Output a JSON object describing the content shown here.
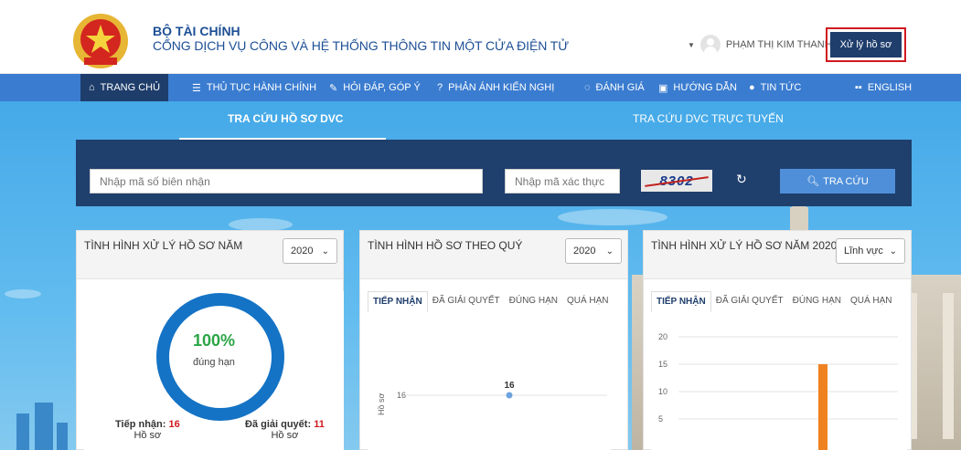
{
  "header": {
    "org_name": "BỘ TÀI CHÍNH",
    "org_subtitle": "CỔNG DỊCH VỤ CÔNG VÀ HỆ THỐNG THÔNG TIN MỘT CỬA ĐIỆN TỬ",
    "user_name": "PHẠM THỊ KIM THANH",
    "process_button": "Xử lý hồ sơ"
  },
  "nav": {
    "items": [
      {
        "label": "TRANG CHỦ",
        "icon": "home-icon"
      },
      {
        "label": "THỦ TỤC HÀNH CHÍNH",
        "icon": "list-icon"
      },
      {
        "label": "HỎI ĐÁP, GÓP Ý",
        "icon": "wrench-icon"
      },
      {
        "label": "PHẢN ÁNH KIẾN NGHỊ",
        "icon": "question-icon"
      },
      {
        "label": "ĐÁNH GIÁ",
        "icon": "chat-icon"
      },
      {
        "label": "HƯỚNG DẪN",
        "icon": "book-icon"
      },
      {
        "label": "TIN TỨC",
        "icon": "location-icon"
      },
      {
        "label": "ENGLISH",
        "icon": "flag-icon"
      }
    ]
  },
  "tabs": {
    "lookup_dvc": "TRA CỨU HỒ SƠ DVC",
    "lookup_online": "TRA CỨU DVC TRỰC TUYẾN"
  },
  "search": {
    "receipt_placeholder": "Nhập mã số biên nhận",
    "captcha_placeholder": "Nhập mã xác thực",
    "captcha_text": "8302",
    "button_label": "TRA CỨU"
  },
  "card1": {
    "title": "TÌNH HÌNH XỬ LÝ HỒ SƠ NĂM",
    "year": "2020",
    "percent": "100%",
    "percent_label": "đúng hạn",
    "received_label": "Tiếp nhận:",
    "received_value": "16",
    "received_unit": "Hồ sơ",
    "resolved_label": "Đã giải quyết:",
    "resolved_value": "11",
    "resolved_unit": "Hồ sơ"
  },
  "card2": {
    "title": "TÌNH HÌNH HỒ SƠ THEO QUÝ",
    "year": "2020",
    "subtabs": [
      "TIẾP NHẬN",
      "ĐÃ GIẢI QUYẾT",
      "ĐÚNG HẠN",
      "QUÁ HẠN"
    ],
    "y_axis_label": "Hồ sơ",
    "tick_label": "16",
    "point_label": "16"
  },
  "card3": {
    "title": "TÌNH HÌNH XỬ LÝ HỒ SƠ NĂM 2020",
    "filter": "Lĩnh vực",
    "subtabs": [
      "TIẾP NHẬN",
      "ĐÃ GIẢI QUYẾT",
      "ĐÚNG HẠN",
      "QUÁ HẠN"
    ],
    "ticks": [
      "20",
      "15",
      "10",
      "5"
    ]
  },
  "chart_data": [
    {
      "type": "line",
      "ylabel": "Hồ sơ",
      "series": [
        {
          "values": [
            16
          ]
        }
      ],
      "data_labels": [
        "16"
      ]
    },
    {
      "type": "bar",
      "ylim": [
        0,
        20
      ],
      "yticks": [
        5,
        10,
        15,
        20
      ],
      "values": [
        15
      ],
      "color": "#f08121"
    }
  ],
  "colors": {
    "brand_dark": "#1f3e6c",
    "nav_blue": "#3a7cd0",
    "accent_red": "#d0191f",
    "success_green": "#2aa545",
    "donut_blue": "#1473c5",
    "bar_orange": "#f08121"
  }
}
